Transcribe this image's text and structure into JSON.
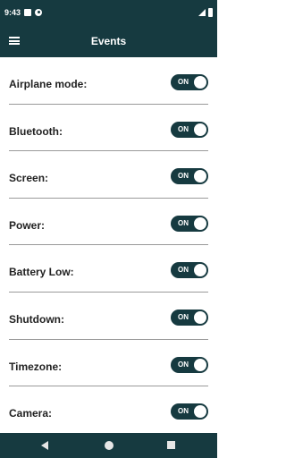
{
  "status_bar": {
    "time": "9:43"
  },
  "app_bar": {
    "title": "Events",
    "menu_icon": "hamburger-menu-icon"
  },
  "events": [
    {
      "label": "Airplane mode:",
      "toggle_text": "ON",
      "state": true
    },
    {
      "label": "Bluetooth:",
      "toggle_text": "ON",
      "state": true
    },
    {
      "label": "Screen:",
      "toggle_text": "ON",
      "state": true
    },
    {
      "label": "Power:",
      "toggle_text": "ON",
      "state": true
    },
    {
      "label": "Battery Low:",
      "toggle_text": "ON",
      "state": true
    },
    {
      "label": "Shutdown:",
      "toggle_text": "ON",
      "state": true
    },
    {
      "label": "Timezone:",
      "toggle_text": "ON",
      "state": true
    },
    {
      "label": "Camera:",
      "toggle_text": "ON",
      "state": true
    }
  ],
  "colors": {
    "primary": "#163a40",
    "background": "#ffffff",
    "text": "#222222",
    "divider": "#9a9a9a"
  },
  "nav_bar": {
    "back_icon": "back-triangle-icon",
    "home_icon": "home-circle-icon",
    "recents_icon": "recents-square-icon"
  }
}
